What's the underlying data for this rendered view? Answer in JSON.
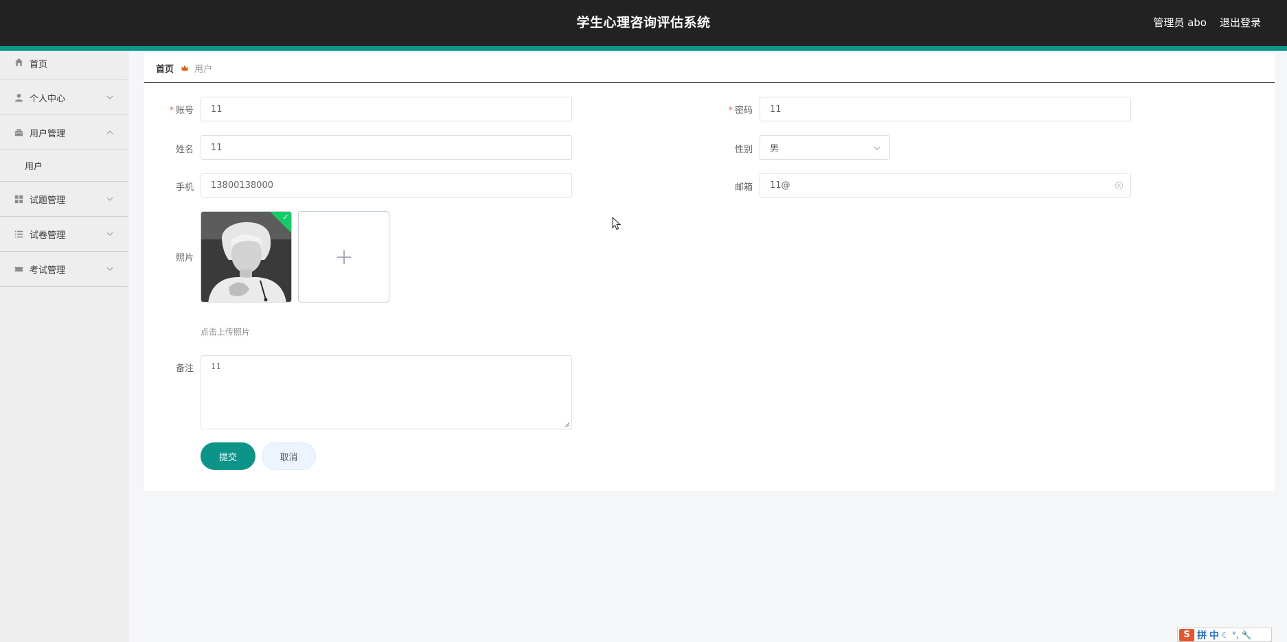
{
  "header": {
    "title": "学生心理咨询评估系统",
    "user": "管理员 abo",
    "logout": "退出登录"
  },
  "sidebar": {
    "items": [
      {
        "label": "首页",
        "icon": "home-icon"
      },
      {
        "label": "个人中心",
        "icon": "user-icon"
      },
      {
        "label": "用户管理",
        "icon": "briefcase-icon",
        "expanded": true,
        "children": [
          {
            "label": "用户"
          }
        ]
      },
      {
        "label": "试题管理",
        "icon": "grid-icon"
      },
      {
        "label": "试卷管理",
        "icon": "list-icon"
      },
      {
        "label": "考试管理",
        "icon": "ticket-icon"
      }
    ]
  },
  "breadcrumb": {
    "home": "首页",
    "current": "用户"
  },
  "form": {
    "account": {
      "label": "账号",
      "value": "11"
    },
    "password": {
      "label": "密码",
      "value": "11"
    },
    "name": {
      "label": "姓名",
      "value": "11"
    },
    "gender": {
      "label": "性别",
      "value": "男"
    },
    "phone": {
      "label": "手机",
      "value": "13800138000"
    },
    "email": {
      "label": "邮箱",
      "value": "11@"
    },
    "photo": {
      "label": "照片",
      "tip": "点击上传照片"
    },
    "remark": {
      "label": "备注",
      "value": "11"
    },
    "submit": "提交",
    "cancel": "取消"
  },
  "ime": {
    "logo": "S",
    "pin": "拼",
    "zhong": "中"
  },
  "colors": {
    "header_bg": "#222222",
    "accent": "#0d9488",
    "required": "#f56c6c",
    "success": "#13ce66"
  }
}
